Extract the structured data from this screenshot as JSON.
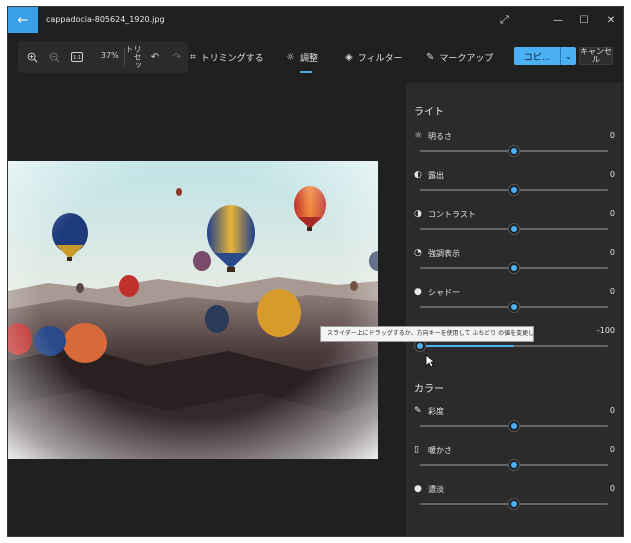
{
  "window": {
    "file_name": "cappadocia-805624_1920.jpg"
  },
  "toolbar": {
    "zoom_level": "37%",
    "reset_label": "リセット",
    "tabs": [
      {
        "label": "トリミングする",
        "icon": "crop-icon"
      },
      {
        "label": "調整",
        "icon": "adjust-icon",
        "active": true
      },
      {
        "label": "フィルター",
        "icon": "filter-icon"
      },
      {
        "label": "マークアップ",
        "icon": "markup-icon"
      }
    ],
    "copy_label": "コピ...",
    "cancel_label": "キャンセル"
  },
  "panel": {
    "light_title": "ライト",
    "light_items": [
      {
        "label": "明るさ",
        "value": "0",
        "icon": "brightness-icon",
        "level": 0.5
      },
      {
        "label": "露出",
        "value": "0",
        "icon": "exposure-icon",
        "level": 0.5
      },
      {
        "label": "コントラスト",
        "value": "0",
        "icon": "contrast-icon",
        "level": 0.5
      },
      {
        "label": "強調表示",
        "value": "0",
        "icon": "highlight-icon",
        "level": 0.5
      },
      {
        "label": "シャドー",
        "value": "0",
        "icon": "shadow-icon",
        "level": 0.5
      }
    ],
    "vignette_value": "-100",
    "vignette_level": 0.0,
    "color_title": "カラー",
    "color_items": [
      {
        "label": "彩度",
        "value": "0",
        "icon": "saturation-icon",
        "level": 0.5
      },
      {
        "label": "暖かさ",
        "value": "0",
        "icon": "warmth-icon",
        "level": 0.5
      },
      {
        "label": "濃淡",
        "value": "0",
        "icon": "tint-icon",
        "level": 0.5
      }
    ]
  },
  "tooltip": {
    "text": "スライダー上にドラッグするか、方向キーを使用して ふちどり の値を変更します"
  },
  "colors": {
    "accent": "#4cb0f5",
    "background": "#202020",
    "panel": "#2b2b2b"
  }
}
